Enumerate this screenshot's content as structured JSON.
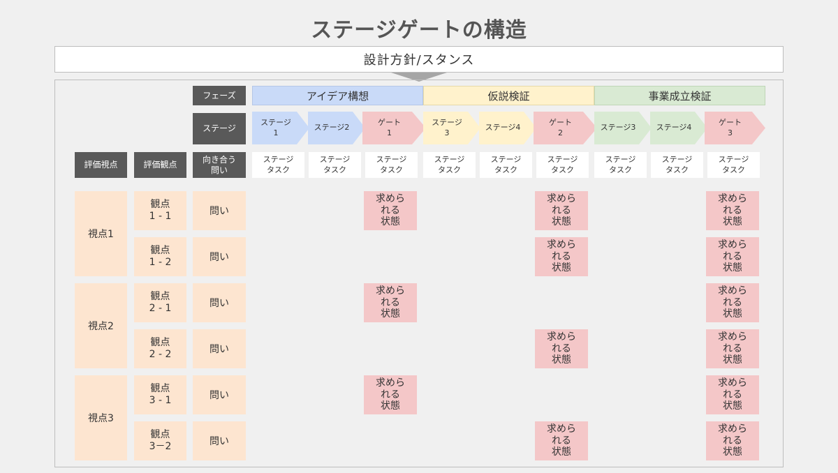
{
  "title": "ステージゲートの構造",
  "policy": "設計方針/スタンス",
  "headers": {
    "phase": "フェーズ",
    "stage": "ステージ",
    "eval_viewpoint": "評価視点",
    "eval_aspect": "評価観点",
    "question_line1": "向き合う",
    "question_line2": "問い"
  },
  "phases": [
    "アイデア構想",
    "仮説検証",
    "事業成立検証"
  ],
  "stages": [
    {
      "line1": "ステージ",
      "line2": "1"
    },
    {
      "line1": "ステージ2",
      "line2": ""
    },
    {
      "line1": "ゲート",
      "line2": "1"
    },
    {
      "line1": "ステージ",
      "line2": "3"
    },
    {
      "line1": "ステージ4",
      "line2": ""
    },
    {
      "line1": "ゲート",
      "line2": "2"
    },
    {
      "line1": "ステージ3",
      "line2": ""
    },
    {
      "line1": "ステージ4",
      "line2": ""
    },
    {
      "line1": "ゲート",
      "line2": "3"
    }
  ],
  "task_label": {
    "line1": "ステージ",
    "line2": "タスク"
  },
  "viewpoints": [
    "視点1",
    "視点2",
    "視点3"
  ],
  "aspects": [
    {
      "line1": "観点",
      "line2": "1 - 1"
    },
    {
      "line1": "観点",
      "line2": "1 - 2"
    },
    {
      "line1": "観点",
      "line2": "2 - 1"
    },
    {
      "line1": "観点",
      "line2": "2 - 2"
    },
    {
      "line1": "観点",
      "line2": "3 - 1"
    },
    {
      "line1": "観点",
      "line2": "3－2"
    }
  ],
  "question": "問い",
  "required_state": {
    "line1": "求めら",
    "line2": "れる",
    "line3": "状態"
  },
  "colors": {
    "phase1": "#c9daf8",
    "phase2": "#fff2cc",
    "phase3": "#d9ead3",
    "gate": "#f4c7c8",
    "peach": "#fde5d0",
    "header": "#595959"
  }
}
